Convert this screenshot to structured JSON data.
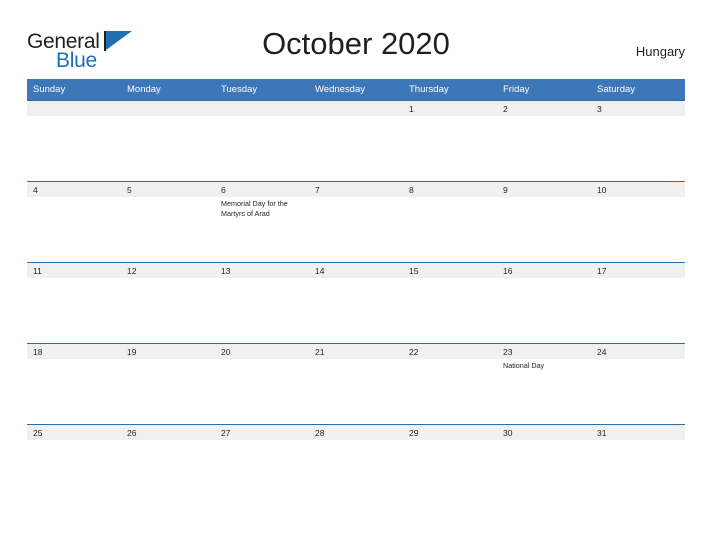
{
  "brand": {
    "name_part1": "General",
    "name_part2": "Blue",
    "accent_color": "#1f6fb5"
  },
  "header": {
    "title": "October 2020",
    "country": "Hungary"
  },
  "theme": {
    "header_blue": "#3d77b8",
    "day_band_gray": "#f0f0f0",
    "rule_blue": "#2b6cab",
    "text_dark": "#231f20"
  },
  "calendar": {
    "month": "October",
    "year": "2020",
    "weekday_headers": [
      "Sunday",
      "Monday",
      "Tuesday",
      "Wednesday",
      "Thursday",
      "Friday",
      "Saturday"
    ],
    "weeks": [
      [
        {
          "day": "",
          "events": []
        },
        {
          "day": "",
          "events": []
        },
        {
          "day": "",
          "events": []
        },
        {
          "day": "",
          "events": []
        },
        {
          "day": "1",
          "events": []
        },
        {
          "day": "2",
          "events": []
        },
        {
          "day": "3",
          "events": []
        }
      ],
      [
        {
          "day": "4",
          "events": []
        },
        {
          "day": "5",
          "events": []
        },
        {
          "day": "6",
          "events": [
            "Memorial Day for the Martyrs of Arad"
          ]
        },
        {
          "day": "7",
          "events": []
        },
        {
          "day": "8",
          "events": []
        },
        {
          "day": "9",
          "events": []
        },
        {
          "day": "10",
          "events": []
        }
      ],
      [
        {
          "day": "11",
          "events": []
        },
        {
          "day": "12",
          "events": []
        },
        {
          "day": "13",
          "events": []
        },
        {
          "day": "14",
          "events": []
        },
        {
          "day": "15",
          "events": []
        },
        {
          "day": "16",
          "events": []
        },
        {
          "day": "17",
          "events": []
        }
      ],
      [
        {
          "day": "18",
          "events": []
        },
        {
          "day": "19",
          "events": []
        },
        {
          "day": "20",
          "events": []
        },
        {
          "day": "21",
          "events": []
        },
        {
          "day": "22",
          "events": []
        },
        {
          "day": "23",
          "events": [
            "National Day"
          ]
        },
        {
          "day": "24",
          "events": []
        }
      ],
      [
        {
          "day": "25",
          "events": []
        },
        {
          "day": "26",
          "events": []
        },
        {
          "day": "27",
          "events": []
        },
        {
          "day": "28",
          "events": []
        },
        {
          "day": "29",
          "events": []
        },
        {
          "day": "30",
          "events": []
        },
        {
          "day": "31",
          "events": []
        }
      ]
    ]
  }
}
